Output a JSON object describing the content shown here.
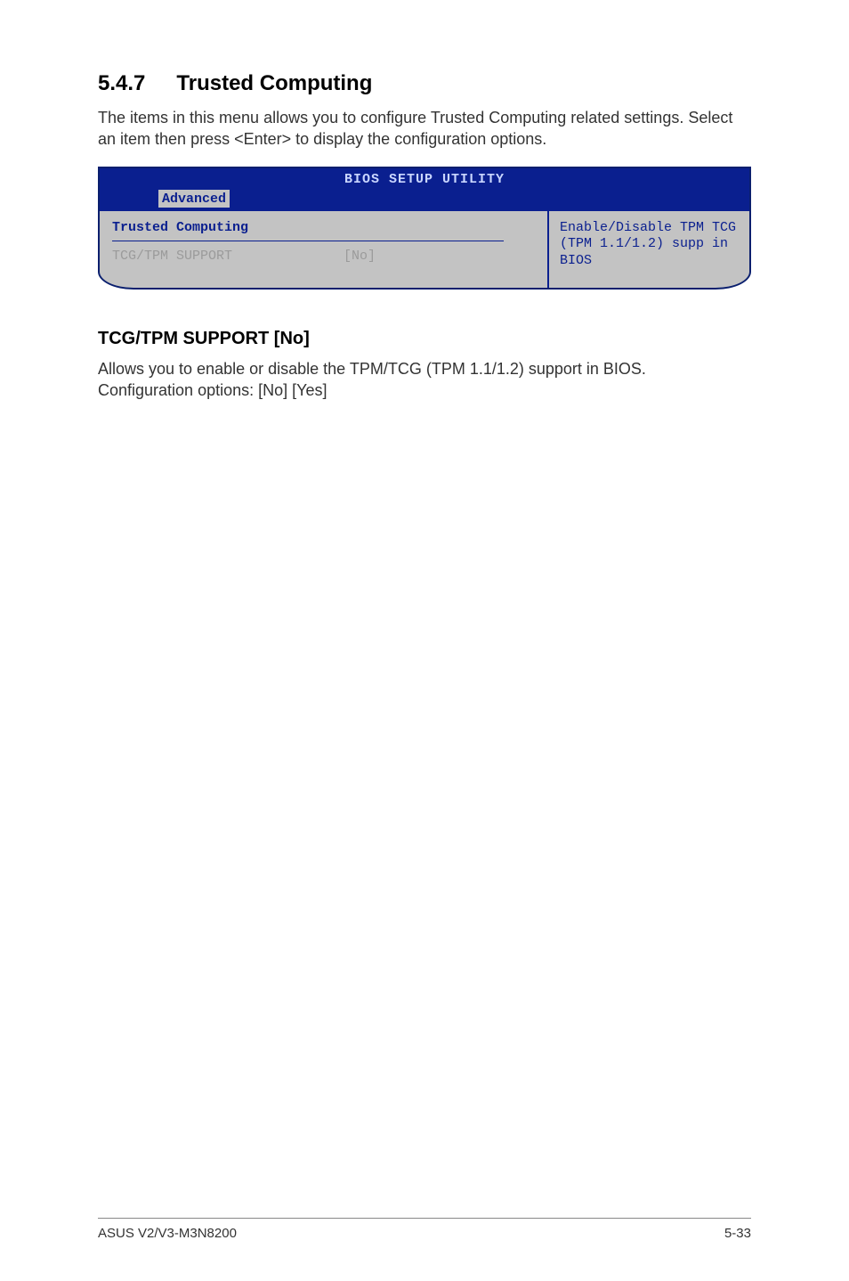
{
  "section": {
    "number": "5.4.7",
    "title": "Trusted Computing",
    "description": "The items in this menu allows you to configure Trusted Computing related settings. Select an item then press <Enter> to display the configuration options."
  },
  "bios": {
    "utility_title": "BIOS SETUP UTILITY",
    "tab": "Advanced",
    "group_title": "Trusted Computing",
    "option_label": "TCG/TPM SUPPORT",
    "option_value": "[No]",
    "help_text": "Enable/Disable TPM TCG (TPM 1.1/1.2) supp in BIOS"
  },
  "subsection": {
    "heading": "TCG/TPM SUPPORT [No]",
    "line1": "Allows you to enable or disable the TPM/TCG (TPM 1.1/1.2) support in BIOS.",
    "line2": "Configuration options: [No] [Yes]"
  },
  "footer": {
    "left": "ASUS V2/V3-M3N8200",
    "right": "5-33"
  }
}
